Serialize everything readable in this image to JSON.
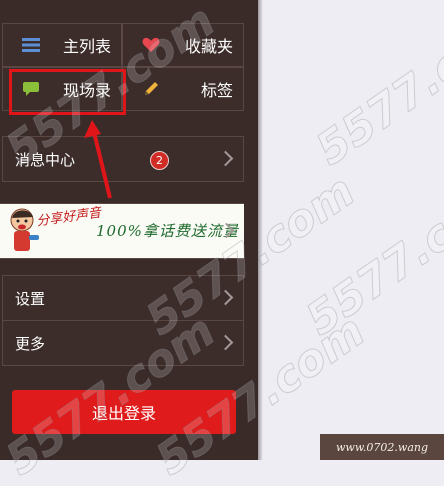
{
  "nav": {
    "list_label": "主列表",
    "favorites_label": "收藏夹",
    "live_label": "现场录",
    "tags_label": "标签"
  },
  "menu": {
    "messages_label": "消息中心",
    "messages_badge": "2",
    "settings_label": "设置",
    "more_label": "更多"
  },
  "banner": {
    "slogan": "分享好声音",
    "text": "100%拿话费送流量"
  },
  "logout_label": "退出登录",
  "watermark": {
    "text": "5577.com",
    "corner_text": "www.0702.wang"
  },
  "colors": {
    "sidebar_bg": "#3a2b29",
    "accent_red": "#e01b1b",
    "heart": "#e8474f",
    "list_icon": "#5b8fd6",
    "chat_icon": "#8bbf3a",
    "pencil_icon": "#f0b43a"
  }
}
